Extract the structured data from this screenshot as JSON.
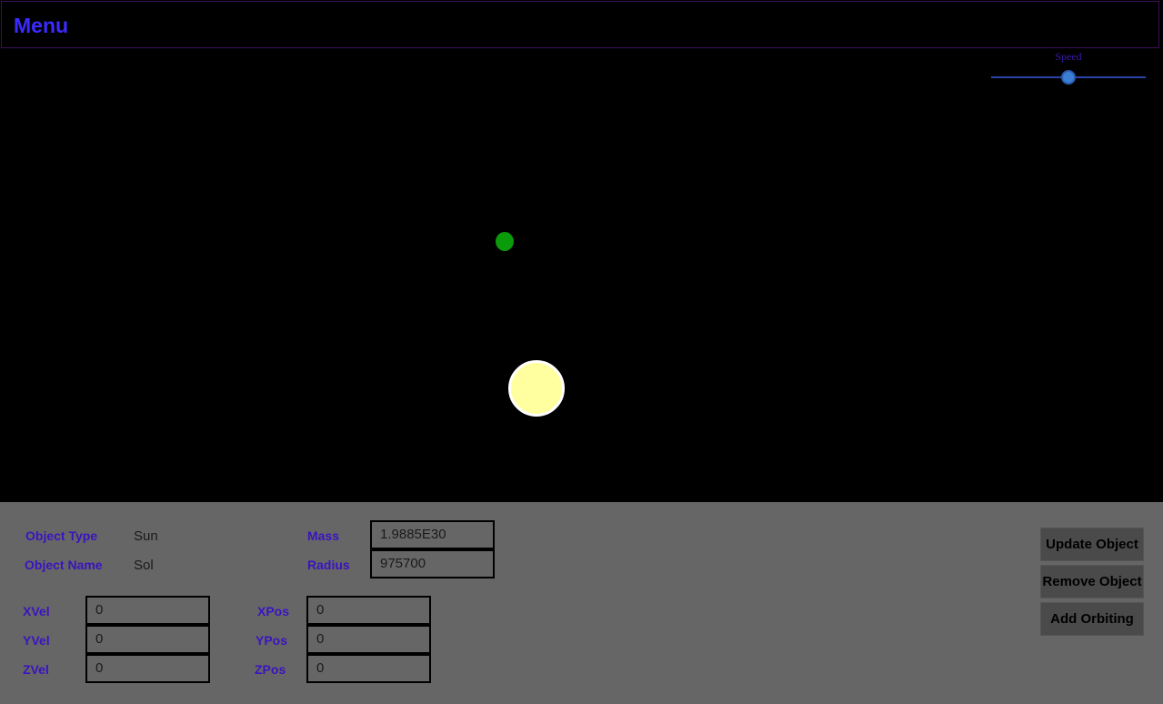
{
  "menu": {
    "title": "Menu"
  },
  "speed": {
    "label": "Speed",
    "value": 0.5
  },
  "scene": {
    "planet_color": "#0a9a0a",
    "sun_color": "#ffffa0"
  },
  "panel": {
    "object_type_label": "Object Type",
    "object_type_value": "Sun",
    "object_name_label": "Object Name",
    "object_name_value": "Sol",
    "mass_label": "Mass",
    "mass_value": "1.9885E30",
    "radius_label": "Radius",
    "radius_value": "975700",
    "xvel_label": "XVel",
    "xvel_value": "0",
    "yvel_label": "YVel",
    "yvel_value": "0",
    "zvel_label": "ZVel",
    "zvel_value": "0",
    "xpos_label": "XPos",
    "xpos_value": "0",
    "ypos_label": "YPos",
    "ypos_value": "0",
    "zpos_label": "ZPos",
    "zpos_value": "0"
  },
  "buttons": {
    "update": "Update Object",
    "remove": "Remove Object",
    "add_orbiting": "Add Orbiting"
  }
}
